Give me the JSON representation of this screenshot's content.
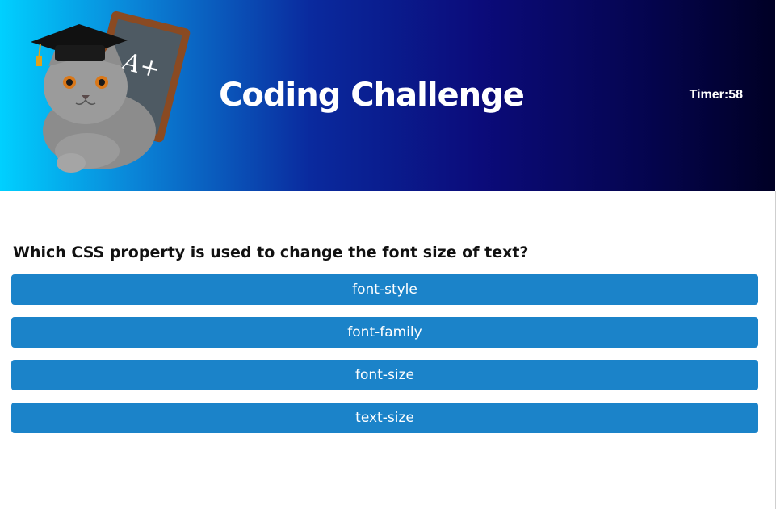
{
  "header": {
    "title": "Coding Challenge",
    "timer_label": "Timer:",
    "timer_value": "58",
    "mascot_board_text": "A+"
  },
  "quiz": {
    "question": "Which CSS property is used to change the font size of text?",
    "answers": [
      {
        "label": "font-style"
      },
      {
        "label": "font-family"
      },
      {
        "label": "font-size"
      },
      {
        "label": "text-size"
      }
    ]
  },
  "colors": {
    "answer_button": "#1b83c9",
    "header_gradient_start": "#00d0ff",
    "header_gradient_end": "#000025"
  },
  "icons": {
    "mascot": "graduate-cat-with-chalkboard-image"
  }
}
